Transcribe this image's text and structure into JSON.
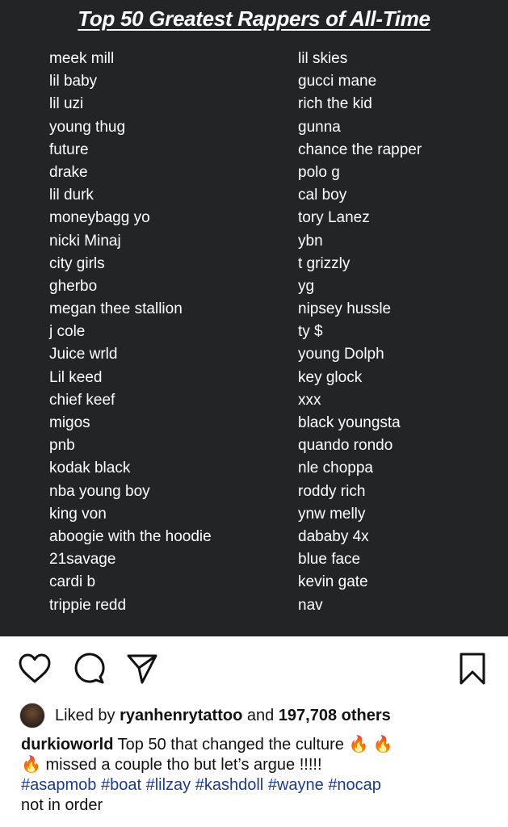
{
  "post": {
    "title": "Top 50 Greatest Rappers of All-Time",
    "left_column": [
      "meek mill",
      "lil baby",
      "lil uzi",
      "young thug",
      "future",
      "drake",
      "lil durk",
      "moneybagg yo",
      "nicki Minaj",
      "city girls",
      "gherbo",
      "megan thee stallion",
      "j cole",
      "Juice wrld",
      "Lil keed",
      "chief keef",
      "migos",
      "pnb",
      "kodak black",
      "nba young boy",
      "king von",
      "aboogie with the hoodie",
      "21savage",
      "cardi b",
      "trippie redd"
    ],
    "right_column": [
      "lil skies",
      "gucci mane",
      "rich the kid",
      "gunna",
      "chance the rapper",
      "polo g",
      "cal boy",
      "tory Lanez",
      "ybn",
      "t grizzly",
      "yg",
      "nipsey hussle",
      "ty $",
      "young Dolph",
      "key glock",
      "xxx",
      "black youngsta",
      "quando rondo",
      "nle choppa",
      "roddy rich",
      "ynw melly",
      "dababy 4x",
      "blue face",
      "kevin gate",
      "nav"
    ]
  },
  "actions": {
    "icons": [
      "heart-icon",
      "comment-icon",
      "share-icon",
      "bookmark-icon"
    ]
  },
  "likes": {
    "prefix": "Liked by",
    "user": "ryanhenrytattoo",
    "conjunction": "and",
    "count_text": "197,708 others"
  },
  "caption": {
    "username": "durkioworld",
    "line1_text": "Top 50 that changed the culture",
    "fire": "🔥",
    "line2_text": "missed a couple tho but let’s argue !!!!!",
    "hashtags": [
      "#asapmob",
      "#boat",
      "#lilzay",
      "#kashdoll",
      "#wayne",
      "#nocap"
    ],
    "trailing": "not in order"
  },
  "colors": {
    "image_bg": "#222426",
    "hashtag": "#1d3b8b"
  }
}
